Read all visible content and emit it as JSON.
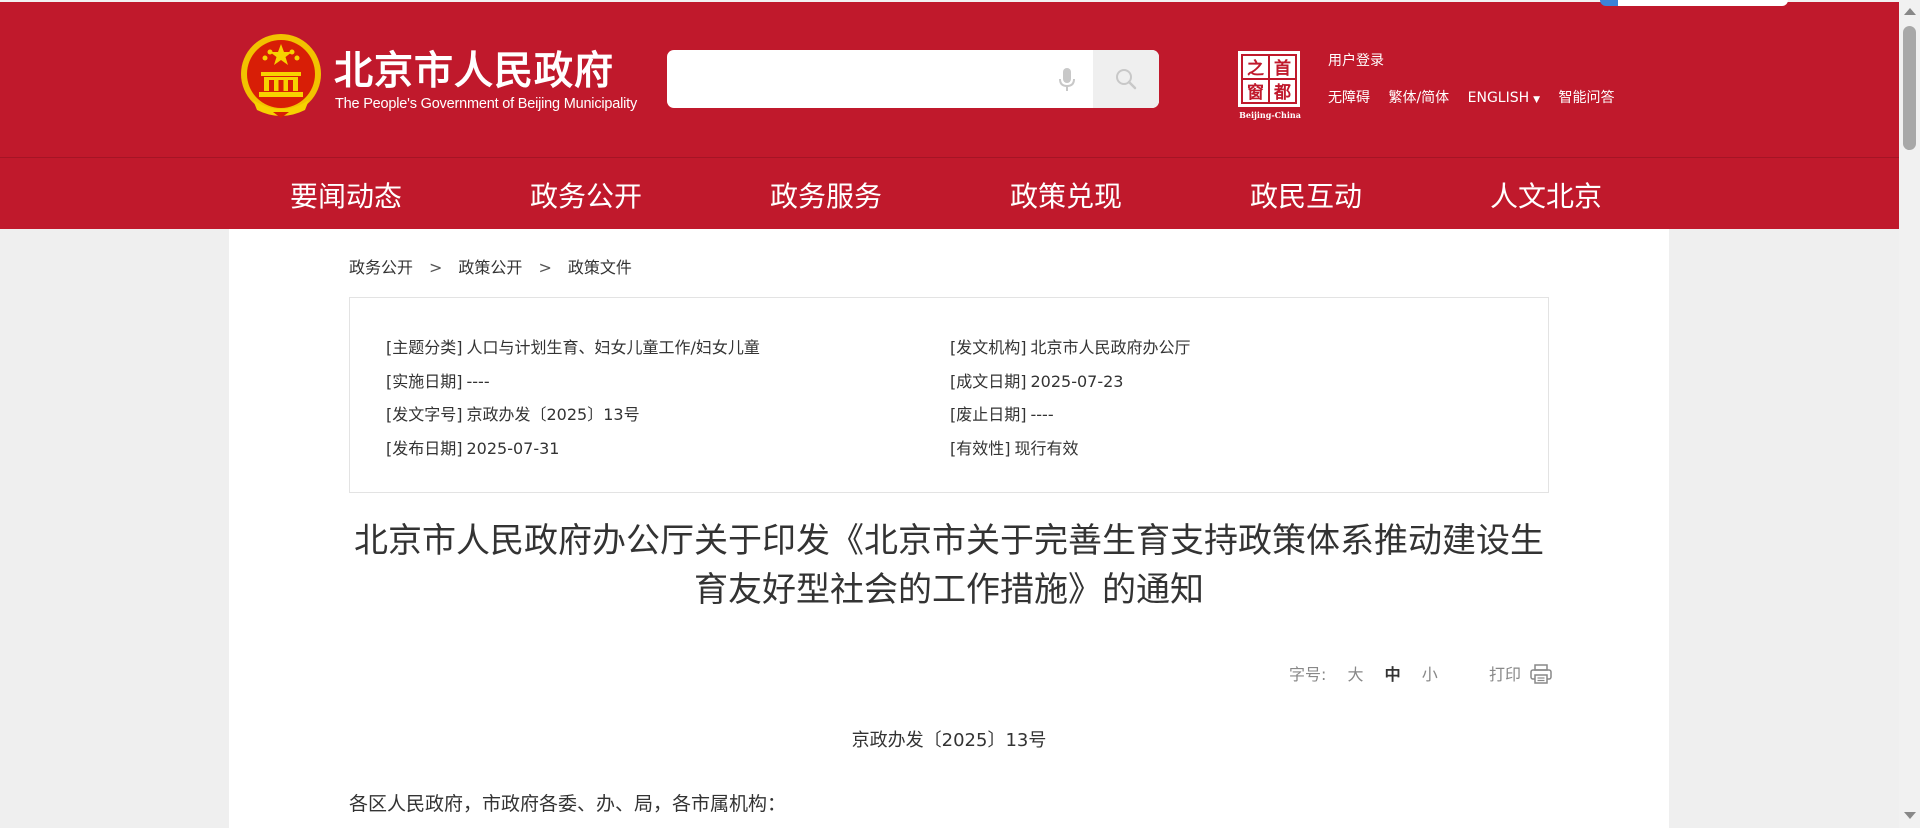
{
  "header": {
    "title_cn": "北京市人民政府",
    "title_en": "The People's Government of Beijing Municipality",
    "search": {
      "value": "",
      "placeholder": ""
    },
    "capital_logo": {
      "chars": [
        "之",
        "首",
        "窗",
        "都"
      ],
      "subtitle": "Beijing-China"
    },
    "user_login": "用户登录",
    "links": {
      "accessibility": "无障碍",
      "traditional_simplified": "繁体/简体",
      "english": "ENGLISH",
      "smart_qa": "智能问答"
    },
    "brand_color": "#c0192c"
  },
  "nav": {
    "items": [
      {
        "label": "要闻动态"
      },
      {
        "label": "政务公开"
      },
      {
        "label": "政务服务"
      },
      {
        "label": "政策兑现"
      },
      {
        "label": "政民互动"
      },
      {
        "label": "人文北京"
      }
    ]
  },
  "breadcrumb": {
    "items": [
      {
        "label": "政务公开"
      },
      {
        "label": "政策公开"
      },
      {
        "label": "政策文件"
      }
    ],
    "separator": ">"
  },
  "meta": {
    "topic_key": "[主题分类]",
    "topic_value": "人口与计划生育、妇女儿童工作/妇女儿童",
    "issuer_key": "[发文机构]",
    "issuer_value": "北京市人民政府办公厅",
    "effective_key": "[实施日期]",
    "effective_value": "----",
    "created_key": "[成文日期]",
    "created_value": "2025-07-23",
    "docno_key": "[发文字号]",
    "docno_value": "京政办发〔2025〕13号",
    "expiry_key": "[废止日期]",
    "expiry_value": "----",
    "published_key": "[发布日期]",
    "published_value": "2025-07-31",
    "validity_key": "[有效性]",
    "validity_value": "现行有效"
  },
  "document": {
    "title_line1": "北京市人民政府办公厅关于印发《北京市关于完善生育支持政策体系推动建设生",
    "title_line2": "育友好型社会的工作措施》的通知",
    "font_size_label": "字号:",
    "font_sizes": [
      "大",
      "中",
      "小"
    ],
    "font_size_selected": "中",
    "print_label": "打印",
    "number": "京政办发〔2025〕13号",
    "salutation": "各区人民政府，市政府各委、办、局，各市属机构："
  }
}
